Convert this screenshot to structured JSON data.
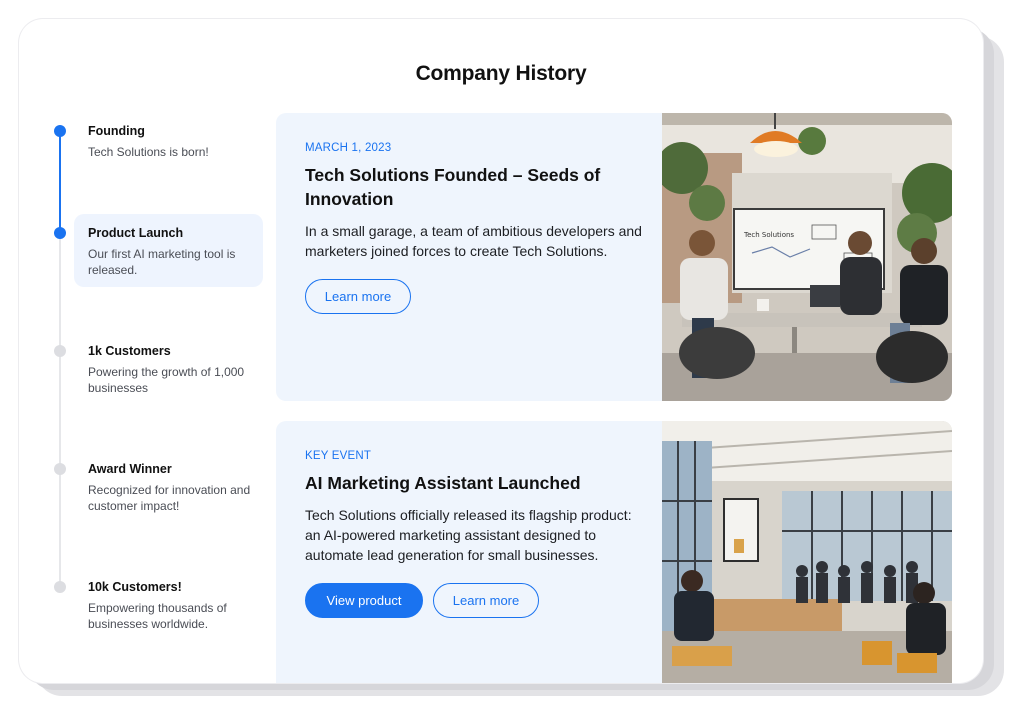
{
  "page": {
    "title": "Company History"
  },
  "timeline": [
    {
      "title": "Founding",
      "desc": "Tech Solutions is born!",
      "active": true
    },
    {
      "title": "Product Launch",
      "desc": "Our first AI marketing tool is released.",
      "active": true
    },
    {
      "title": "1k Customers",
      "desc": "Powering the growth of 1,000 businesses",
      "active": false
    },
    {
      "title": "Award Winner",
      "desc": "Recognized for innovation and customer impact!",
      "active": false
    },
    {
      "title": "10k Customers!",
      "desc": "Empowering thousands of businesses worldwide.",
      "active": false
    }
  ],
  "events": [
    {
      "eyebrow": "MARCH 1, 2023",
      "title": "Tech Solutions Founded – Seeds of Innovation",
      "body": "In a small garage, a team of ambitious developers and marketers joined forces to create Tech Solutions.",
      "primary_label": "",
      "secondary_label": "Learn more",
      "whiteboard_text": "Tech Solutions"
    },
    {
      "eyebrow": "KEY EVENT",
      "title": "AI Marketing Assistant Launched",
      "body": "Tech Solutions officially released its flagship product: an AI-powered marketing assistant designed to automate lead generation for small businesses.",
      "primary_label": "View product",
      "secondary_label": "Learn more"
    }
  ],
  "colors": {
    "accent": "#1a73f0",
    "panel_bg": "#eff5fd",
    "timeline_inactive": "#dcdde1"
  }
}
